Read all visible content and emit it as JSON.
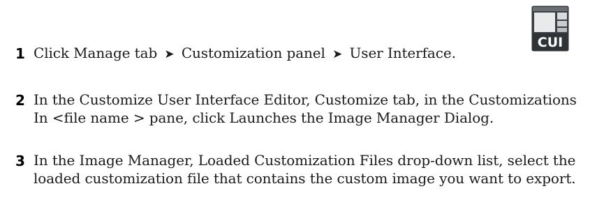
{
  "steps": [
    {
      "number": "1",
      "parts": [
        "Click Manage tab",
        "Customization panel",
        "User Interface."
      ],
      "separator": "➤"
    },
    {
      "number": "2",
      "text": "In the Customize User Interface Editor, Customize tab, in the Customizations In <file name > pane, click Launches the Image Manager Dialog."
    },
    {
      "number": "3",
      "text": "In the Image Manager, Loaded Customization Files drop-down list, select the loaded customization file that contains the custom image you want to export."
    }
  ],
  "icon": {
    "name": "cui-icon",
    "label": "CUI",
    "colors": {
      "frame": "#5a5d62",
      "body": "#3c3f44",
      "panel": "#e8eaec",
      "label": "#ffffff"
    }
  }
}
